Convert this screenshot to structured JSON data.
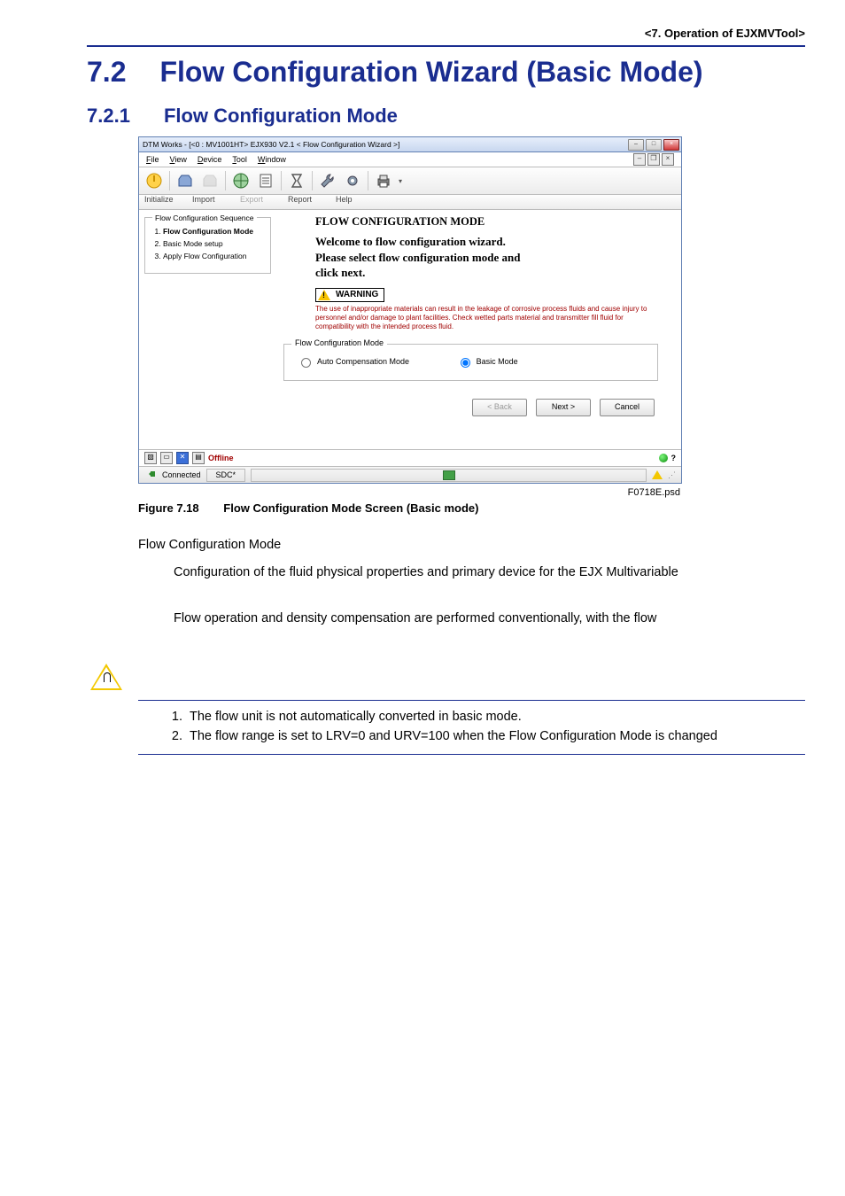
{
  "header": {
    "running_head": "<7.  Operation of EJXMVTool>"
  },
  "titles": {
    "h1_num": "7.2",
    "h1_text": "Flow Configuration Wizard (Basic Mode)",
    "h2_num": "7.2.1",
    "h2_text": "Flow Configuration Mode"
  },
  "screenshot": {
    "window_title": "DTM Works - [<0 : MV1001HT> EJX930 V2.1 < Flow Configuration Wizard >]",
    "menu": {
      "file": "File",
      "view": "View",
      "device": "Device",
      "tool": "Tool",
      "window": "Window"
    },
    "toolbar_labels": {
      "initialize": "Initialize",
      "import": "Import",
      "export": "Export",
      "report": "Report",
      "help": "Help"
    },
    "main_title": "FLOW CONFIGURATION MODE",
    "sequence": {
      "legend": "Flow Configuration Sequence",
      "s1": "Flow Configuration Mode",
      "s2": "Basic Mode setup",
      "s3": "Apply Flow Configuration"
    },
    "welcome_l1": "Welcome to flow configuration wizard.",
    "welcome_l2": "Please select flow configuration mode and",
    "welcome_l3": "click next.",
    "warning_label": "WARNING",
    "warning_text": "The use of inappropriate materials can result in the leakage of corrosive process fluids and cause injury to personnel and/or damage to plant facilities. Check wetted parts material and transmitter fill fluid for compatibility with the intended process fluid.",
    "mode_legend": "Flow Configuration Mode",
    "radio_auto": "Auto Compensation Mode",
    "radio_basic": "Basic Mode",
    "btn_back": "< Back",
    "btn_next": "Next >",
    "btn_cancel": "Cancel",
    "status_offline": "Offline",
    "status_connected": "Connected",
    "status_sdc": "SDC*",
    "psd_label": "F0718E.psd"
  },
  "figure": {
    "num": "Figure 7.18",
    "caption": "Flow Configuration Mode Screen (Basic mode)"
  },
  "body": {
    "p1": "Flow Configuration Mode",
    "p2": "Configuration of the fluid physical properties and primary device for the EJX Multivariable",
    "p3": "Flow operation and density compensation are performed conventionally, with the flow"
  },
  "notes": {
    "n1": "The flow unit is not automatically converted in basic mode.",
    "n2": "The flow range is set to LRV=0 and URV=100 when the Flow Configuration Mode is changed"
  }
}
